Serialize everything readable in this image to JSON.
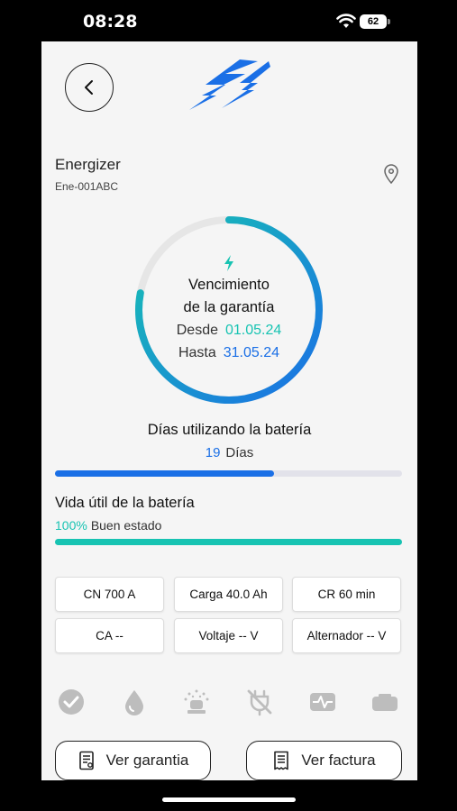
{
  "status_bar": {
    "time": "08:28",
    "battery": "62"
  },
  "device": {
    "name": "Energizer",
    "code": "Ene-001ABC"
  },
  "warranty": {
    "title_line1": "Vencimiento",
    "title_line2": "de la garantía",
    "from_label": "Desde",
    "from_value": "01.05.24",
    "to_label": "Hasta",
    "to_value": "31.05.24",
    "progress": 0.78
  },
  "usage": {
    "title": "Días utilizando la batería",
    "days": "19",
    "unit": "Días",
    "progress": 0.63
  },
  "life": {
    "title": "Vida útil de la batería",
    "percent": "100%",
    "status": "Buen estado",
    "progress": 1.0
  },
  "specs": [
    {
      "label": "CN 700 A"
    },
    {
      "label": "Carga 40.0 Ah"
    },
    {
      "label": "CR 60 min"
    },
    {
      "label": "CA --"
    },
    {
      "label": "Voltaje -- V"
    },
    {
      "label": "Alternador -- V"
    }
  ],
  "status_icons": [
    "check-circle-icon",
    "water-drop-icon",
    "siren-icon",
    "no-plug-icon",
    "pulse-icon",
    "battery-case-icon"
  ],
  "actions": {
    "warranty_label": "Ver garantia",
    "invoice_label": "Ver factura"
  },
  "colors": {
    "accent_blue": "#1a6fe6",
    "accent_green": "#17c3b2",
    "icon_gray": "#bdbdbd"
  }
}
